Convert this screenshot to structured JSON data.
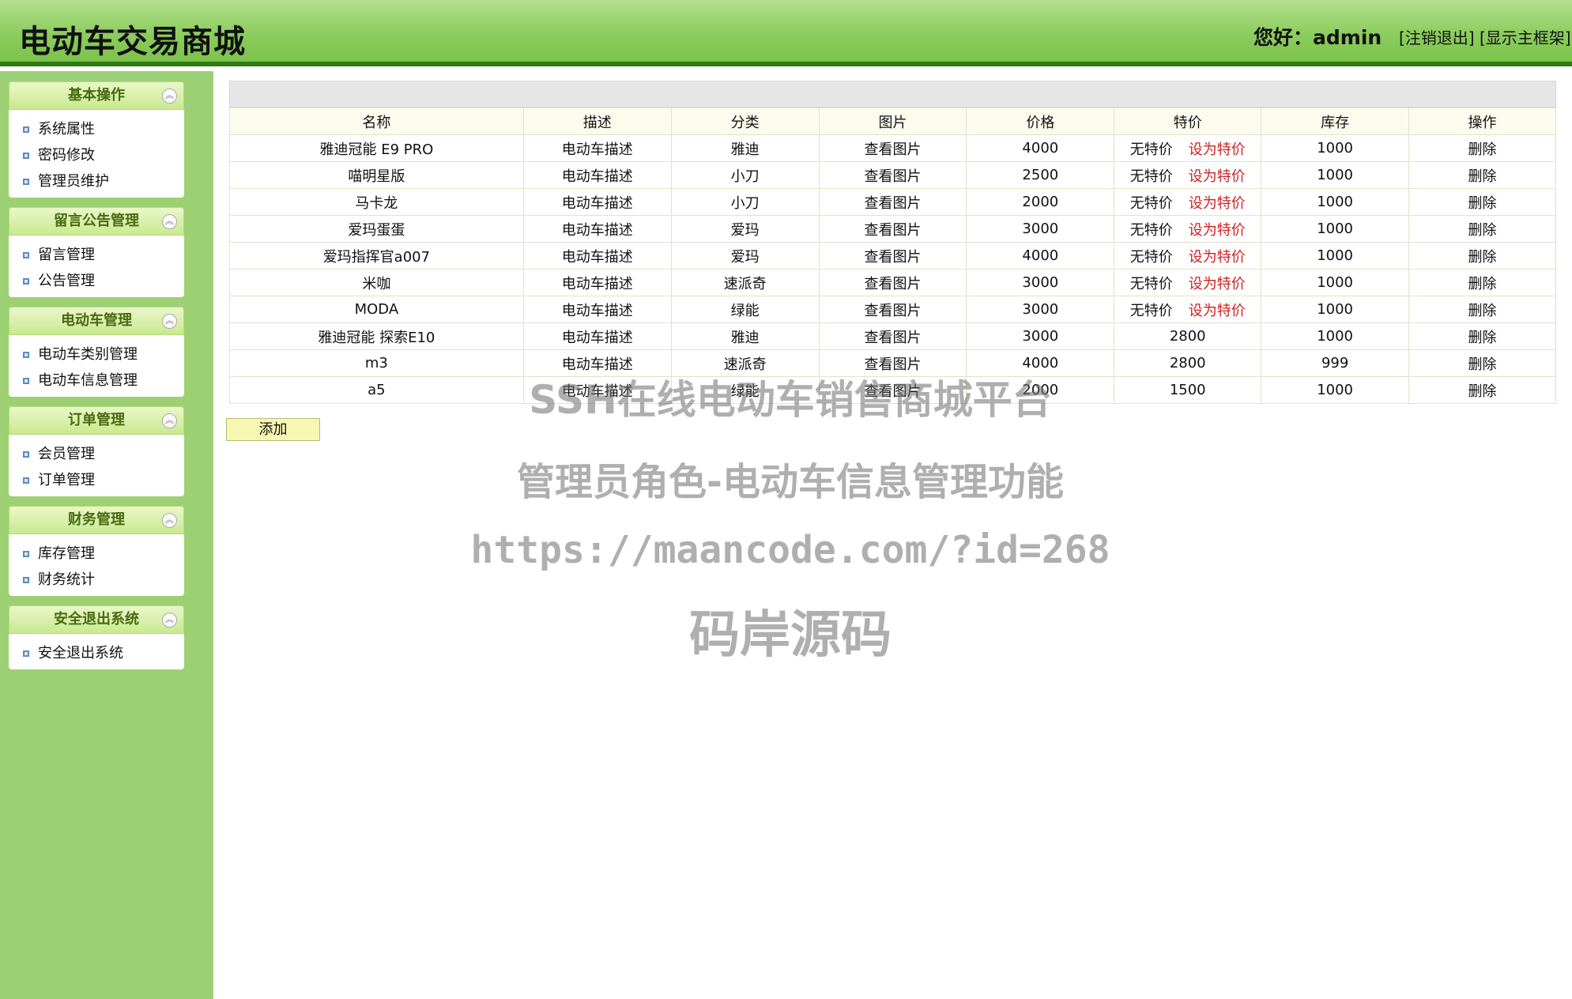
{
  "header": {
    "title": "电动车交易商城",
    "greeting": "您好：admin",
    "logout_link": "[注销退出]",
    "show_frame_link": "[显示主框架]"
  },
  "sidebar": {
    "panels": [
      {
        "title": "基本操作",
        "items": [
          "系统属性",
          "密码修改",
          "管理员维护"
        ]
      },
      {
        "title": "留言公告管理",
        "items": [
          "留言管理",
          "公告管理"
        ]
      },
      {
        "title": "电动车管理",
        "items": [
          "电动车类别管理",
          "电动车信息管理"
        ]
      },
      {
        "title": "订单管理",
        "items": [
          "会员管理",
          "订单管理"
        ]
      },
      {
        "title": "财务管理",
        "items": [
          "库存管理",
          "财务统计"
        ]
      },
      {
        "title": "安全退出系统",
        "items": [
          "安全退出系统"
        ]
      }
    ]
  },
  "table": {
    "headers": [
      "名称",
      "描述",
      "分类",
      "图片",
      "价格",
      "特价",
      "库存",
      "操作"
    ],
    "rows": [
      {
        "name": "雅迪冠能 E9 PRO",
        "desc": "电动车描述",
        "category": "雅迪",
        "pic": "查看图片",
        "price": "4000",
        "special": "无特价",
        "set_special": "设为特价",
        "stock": "1000",
        "op": "删除"
      },
      {
        "name": "喵明星版",
        "desc": "电动车描述",
        "category": "小刀",
        "pic": "查看图片",
        "price": "2500",
        "special": "无特价",
        "set_special": "设为特价",
        "stock": "1000",
        "op": "删除"
      },
      {
        "name": "马卡龙",
        "desc": "电动车描述",
        "category": "小刀",
        "pic": "查看图片",
        "price": "2000",
        "special": "无特价",
        "set_special": "设为特价",
        "stock": "1000",
        "op": "删除"
      },
      {
        "name": "爱玛蛋蛋",
        "desc": "电动车描述",
        "category": "爱玛",
        "pic": "查看图片",
        "price": "3000",
        "special": "无特价",
        "set_special": "设为特价",
        "stock": "1000",
        "op": "删除"
      },
      {
        "name": "爱玛指挥官a007",
        "desc": "电动车描述",
        "category": "爱玛",
        "pic": "查看图片",
        "price": "4000",
        "special": "无特价",
        "set_special": "设为特价",
        "stock": "1000",
        "op": "删除"
      },
      {
        "name": "米咖",
        "desc": "电动车描述",
        "category": "速派奇",
        "pic": "查看图片",
        "price": "3000",
        "special": "无特价",
        "set_special": "设为特价",
        "stock": "1000",
        "op": "删除"
      },
      {
        "name": "MODA",
        "desc": "电动车描述",
        "category": "绿能",
        "pic": "查看图片",
        "price": "3000",
        "special": "无特价",
        "set_special": "设为特价",
        "stock": "1000",
        "op": "删除"
      },
      {
        "name": "雅迪冠能 探索E10",
        "desc": "电动车描述",
        "category": "雅迪",
        "pic": "查看图片",
        "price": "3000",
        "special": "2800",
        "set_special": "",
        "stock": "1000",
        "op": "删除"
      },
      {
        "name": "m3",
        "desc": "电动车描述",
        "category": "速派奇",
        "pic": "查看图片",
        "price": "4000",
        "special": "2800",
        "set_special": "",
        "stock": "999",
        "op": "删除"
      },
      {
        "name": "a5",
        "desc": "电动车描述",
        "category": "绿能",
        "pic": "查看图片",
        "price": "2000",
        "special": "1500",
        "set_special": "",
        "stock": "1000",
        "op": "删除"
      }
    ]
  },
  "add_button": "添加",
  "watermark": {
    "line1": "SSH在线电动车销售商城平台",
    "line2": "管理员角色-电动车信息管理功能",
    "line3": "https://maancode.com/?id=268",
    "line4": "码岸源码"
  }
}
